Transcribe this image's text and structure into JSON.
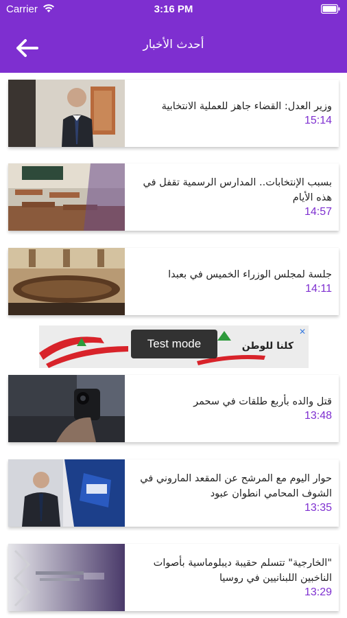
{
  "status_bar": {
    "carrier": "Carrier",
    "time": "3:16 PM"
  },
  "header": {
    "title": "أحدث الأخبار"
  },
  "news": [
    {
      "headline": "وزير العدل: القضاء جاهز للعملية الانتخابية",
      "time": "15:14"
    },
    {
      "headline": "بسبب الإنتخابات.. المدارس الرسمية تقفل في هذه الأيام",
      "time": "14:57"
    },
    {
      "headline": "جلسة لمجلس الوزراء الخميس في بعبدا",
      "time": "14:11"
    },
    {
      "headline": "قتل والده بأربع طلقات في سحمر",
      "time": "13:48"
    },
    {
      "headline": "حوار اليوم مع المرشح عن المقعد الماروني في الشوف المحامي انطوان عبود",
      "time": "13:35"
    },
    {
      "headline": "\"الخارجية\" تتسلم حقيبة ديبلوماسية بأصوات الناخبين اللبنانيين في روسيا",
      "time": "13:29"
    }
  ],
  "ad": {
    "slogan": "كلنا للوطن",
    "badge": "Test mode",
    "close": "✕"
  },
  "colors": {
    "accent": "#7e2fd0",
    "time_text": "#7e2fd0"
  }
}
